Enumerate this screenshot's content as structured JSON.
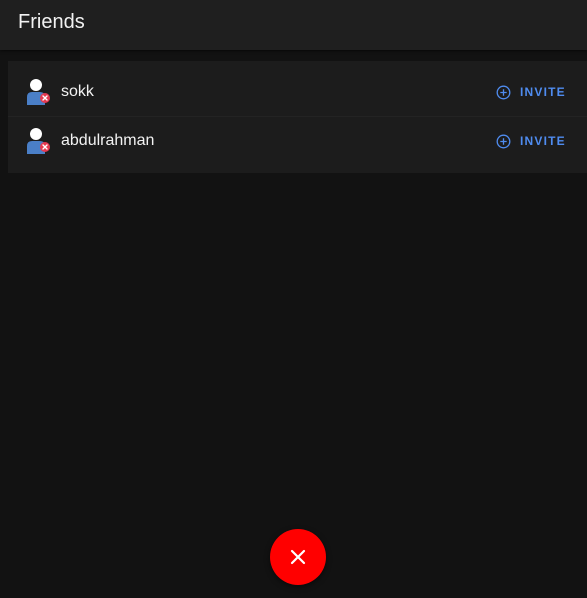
{
  "header": {
    "title": "Friends"
  },
  "friends": [
    {
      "name": "sokk",
      "invite_label": "INVITE",
      "avatar_icon": "user-offline-icon"
    },
    {
      "name": "abdulrahman",
      "invite_label": "INVITE",
      "avatar_icon": "user-offline-icon"
    }
  ],
  "fab": {
    "icon": "close-icon"
  },
  "colors": {
    "background": "#121212",
    "header": "#1f1f1f",
    "list": "#1c1c1c",
    "accent": "#4f8cf0",
    "fab": "#ff0000",
    "status_offline": "#e53950"
  }
}
